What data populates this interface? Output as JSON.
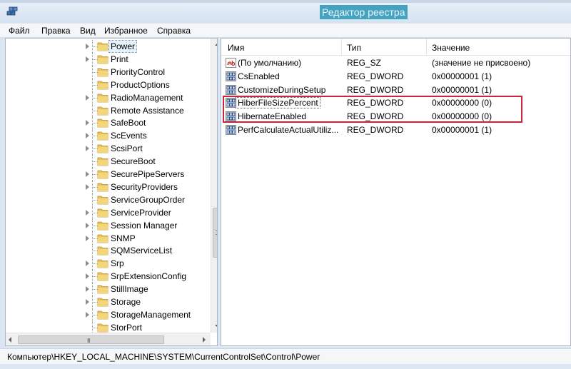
{
  "window": {
    "title": "Редактор реестра",
    "icon": "regedit-icon"
  },
  "menu": {
    "file": "Файл",
    "edit": "Правка",
    "view": "Вид",
    "favorites": "Избранное",
    "help": "Справка"
  },
  "tree": {
    "items": [
      {
        "label": "Power",
        "expandable": true,
        "selected": true
      },
      {
        "label": "Print",
        "expandable": true
      },
      {
        "label": "PriorityControl",
        "expandable": false
      },
      {
        "label": "ProductOptions",
        "expandable": false
      },
      {
        "label": "RadioManagement",
        "expandable": true
      },
      {
        "label": "Remote Assistance",
        "expandable": false
      },
      {
        "label": "SafeBoot",
        "expandable": true
      },
      {
        "label": "ScEvents",
        "expandable": true
      },
      {
        "label": "ScsiPort",
        "expandable": true
      },
      {
        "label": "SecureBoot",
        "expandable": false
      },
      {
        "label": "SecurePipeServers",
        "expandable": true
      },
      {
        "label": "SecurityProviders",
        "expandable": true
      },
      {
        "label": "ServiceGroupOrder",
        "expandable": false
      },
      {
        "label": "ServiceProvider",
        "expandable": true
      },
      {
        "label": "Session Manager",
        "expandable": true
      },
      {
        "label": "SNMP",
        "expandable": true
      },
      {
        "label": "SQMServiceList",
        "expandable": false
      },
      {
        "label": "Srp",
        "expandable": true
      },
      {
        "label": "SrpExtensionConfig",
        "expandable": true
      },
      {
        "label": "StillImage",
        "expandable": true
      },
      {
        "label": "Storage",
        "expandable": true
      },
      {
        "label": "StorageManagement",
        "expandable": true
      },
      {
        "label": "StorPort",
        "expandable": false
      }
    ],
    "hscroll_grip": "III"
  },
  "list": {
    "columns": {
      "name": "Имя",
      "type": "Тип",
      "data": "Значение"
    },
    "rows": [
      {
        "icon": "string-value-icon",
        "name": "(По умолчанию)",
        "type": "REG_SZ",
        "data": "(значение не присвоено)"
      },
      {
        "icon": "binary-value-icon",
        "name": "CsEnabled",
        "type": "REG_DWORD",
        "data": "0x00000001 (1)"
      },
      {
        "icon": "binary-value-icon",
        "name": "CustomizeDuringSetup",
        "type": "REG_DWORD",
        "data": "0x00000001 (1)"
      },
      {
        "icon": "binary-value-icon",
        "name": "HiberFileSizePercent",
        "type": "REG_DWORD",
        "data": "0x00000000 (0)",
        "focused": true
      },
      {
        "icon": "binary-value-icon",
        "name": "HibernateEnabled",
        "type": "REG_DWORD",
        "data": "0x00000000 (0)"
      },
      {
        "icon": "binary-value-icon",
        "name": "PerfCalculateActualUtiliz...",
        "type": "REG_DWORD",
        "data": "0x00000001 (1)"
      }
    ]
  },
  "status": {
    "path": "Компьютер\\HKEY_LOCAL_MACHINE\\SYSTEM\\CurrentControlSet\\Control\\Power"
  },
  "colors": {
    "highlight_border": "#c8263a",
    "title_bg": "#46a3c0",
    "folder": "#e8c15a"
  }
}
